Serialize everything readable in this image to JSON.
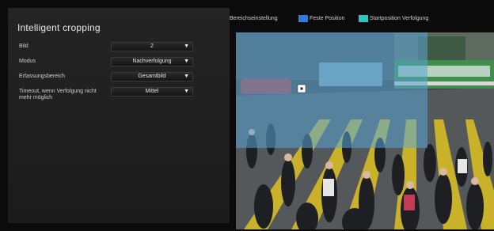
{
  "panel": {
    "title": "Intelligent cropping",
    "rows": [
      {
        "label": "Bild",
        "value": "2"
      },
      {
        "label": "Modus",
        "value": "Nachverfolgung"
      },
      {
        "label": "Erfassungsbereich",
        "value": "Gesamtbild"
      },
      {
        "label": "Timeout, wenn Verfolgung nicht mehr möglich",
        "value": "Mittel"
      }
    ]
  },
  "legend": {
    "title": "Bereichseinstellung",
    "items": [
      {
        "label": "Feste Position",
        "color": "#2e7bdc"
      },
      {
        "label": "Startposition Verfolgung",
        "color": "#2ec4c0"
      }
    ]
  },
  "icons": {
    "dropdown": "caret-down-icon",
    "marker": "crop-center-marker-icon"
  },
  "colors": {
    "overlay": "#5aa6d6",
    "background": "#0b0b0b",
    "panel": "#222222"
  }
}
